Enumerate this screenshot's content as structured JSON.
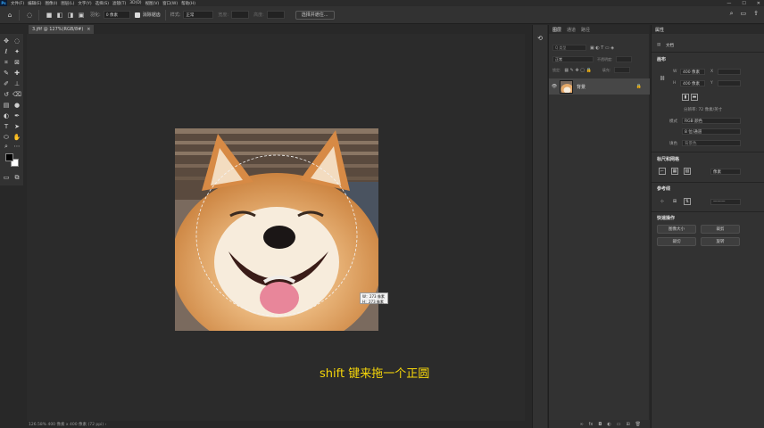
{
  "menubar": {
    "logo": "Ps",
    "items": [
      "文件(F)",
      "编辑(E)",
      "图像(I)",
      "图层(L)",
      "文字(Y)",
      "选择(S)",
      "滤镜(T)",
      "3D(D)",
      "视图(V)",
      "窗口(W)",
      "帮助(H)"
    ],
    "controls": [
      "—",
      "☐",
      "✕"
    ]
  },
  "options": {
    "feather_label": "羽化:",
    "feather_value": "0 像素",
    "antialias_label": "消除锯齿",
    "style_label": "样式:",
    "style_value": "正常",
    "width_label": "宽度:",
    "height_label": "高度:",
    "select_mask_button": "选择并遮住..."
  },
  "document": {
    "tab_title": "3.jfif @ 127%(RGB/8#)",
    "tab_close": "×",
    "status": "126.58%   400 像素 x 400 像素 (72 ppi)   ›"
  },
  "selection_info": {
    "w": "W：273 像素",
    "h": "H：273 像素"
  },
  "subtitle": "shift 键来拖一个正圆",
  "layers_panel": {
    "tabs": [
      "图层",
      "通道",
      "路径"
    ],
    "filter_placeholder": "Q 类型",
    "blend_mode": "正常",
    "opacity_label": "不透明度:",
    "lock_label": "锁定:",
    "fill_label": "填充:",
    "layer_name": "背景"
  },
  "properties": {
    "title": "属性",
    "doc_label": "文档",
    "canvas_title": "画布",
    "w_label": "W",
    "w_value": "400 像素",
    "h_label": "H",
    "h_value": "400 像素",
    "x_label": "X",
    "y_label": "Y",
    "resolution": "分辨率: 72 像素/英寸",
    "mode_label": "模式",
    "mode_value": "RGB 颜色",
    "depth_value": "8 位/通道",
    "fill_label": "填色",
    "fill_value": "背景色",
    "rulers_title": "标尺和网格",
    "units_value": "像素",
    "guides_title": "参考线",
    "quick_title": "快速操作",
    "btn_image_size": "图像大小",
    "btn_crop": "裁剪",
    "btn_trim": "裁切",
    "btn_rotate": "旋转"
  }
}
